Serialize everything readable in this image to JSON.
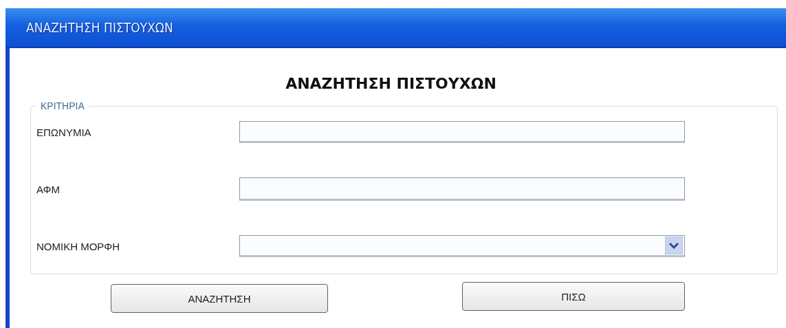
{
  "window": {
    "title": "ΑΝΑΖΗΤΗΣΗ ΠΙΣΤΟΥΧΩΝ"
  },
  "heading": "ΑΝΑΖΗΤΗΣΗ ΠΙΣΤΟΥΧΩΝ",
  "criteria": {
    "legend": "ΚΡΙΤΗΡΙΑ",
    "fields": [
      {
        "label": "ΕΠΩΝΥΜΙΑ",
        "kind": "text"
      },
      {
        "label": "ΑΦΜ",
        "kind": "text"
      },
      {
        "label": "ΝΟΜΙΚΗ ΜΟΡΦΗ",
        "kind": "dropdown"
      }
    ]
  },
  "buttons": [
    "ΑΝΑΖΗΤΗΣΗ",
    "ΠΙΣΩ"
  ]
}
